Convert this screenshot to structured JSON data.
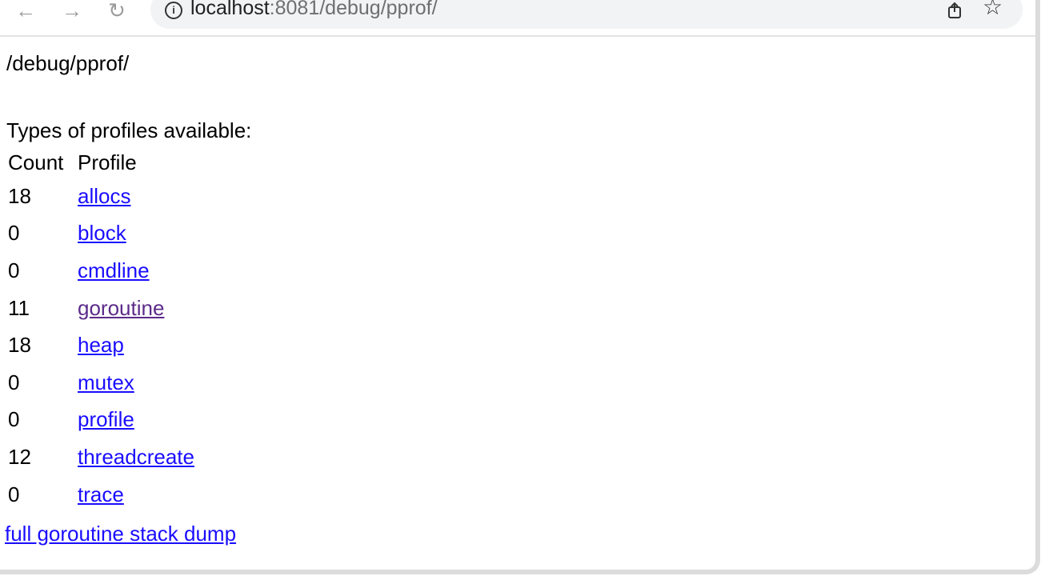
{
  "browser": {
    "back_icon": "back-arrow-icon",
    "forward_icon": "forward-arrow-icon",
    "reload_icon": "reload-icon",
    "url_host": "localhost",
    "url_path": ":8081/debug/pprof/",
    "share_icon": "share-icon",
    "bookmark_icon": "star-icon"
  },
  "page": {
    "title": "/debug/pprof/",
    "subtitle": "Types of profiles available:",
    "table": {
      "headers": [
        "Count",
        "Profile"
      ],
      "rows": [
        {
          "count": "18",
          "profile": "allocs"
        },
        {
          "count": "0",
          "profile": "block"
        },
        {
          "count": "0",
          "profile": "cmdline"
        },
        {
          "count": "11",
          "profile": "goroutine"
        },
        {
          "count": "18",
          "profile": "heap"
        },
        {
          "count": "0",
          "profile": "mutex"
        },
        {
          "count": "0",
          "profile": "profile"
        },
        {
          "count": "12",
          "profile": "threadcreate"
        },
        {
          "count": "0",
          "profile": "trace"
        }
      ]
    },
    "dump_link": "full goroutine stack dump"
  },
  "colors": {
    "link": "#1a0dff",
    "visited_link": "#5c2b8a"
  }
}
